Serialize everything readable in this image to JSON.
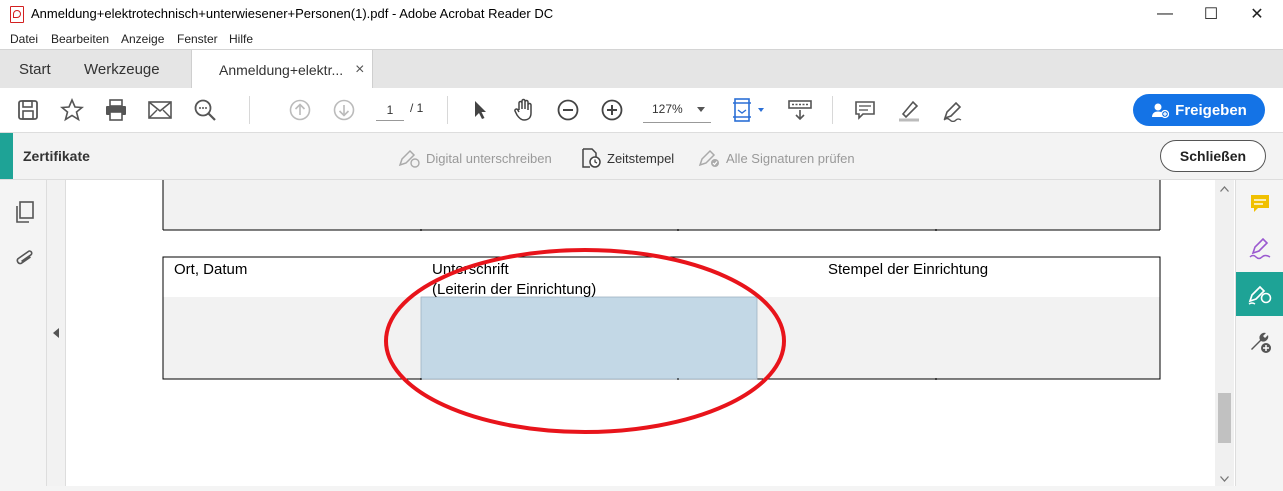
{
  "window": {
    "title": "Anmeldung+elektrotechnisch+unterwiesener+Personen(1).pdf - Adobe Acrobat Reader DC",
    "minimize": "—",
    "maximize": "☐",
    "close": "✕"
  },
  "menu": [
    "Datei",
    "Bearbeiten",
    "Anzeige",
    "Fenster",
    "Hilfe"
  ],
  "tabs": {
    "start": "Start",
    "tools": "Werkzeuge",
    "document": "Anmeldung+elektr...",
    "document_close": "×"
  },
  "toolbar": {
    "page_current": "1",
    "page_total": "/ 1",
    "zoom": "127%",
    "share_label": "Freigeben"
  },
  "certbar": {
    "title": "Zertifikate",
    "digital_sign": "Digital unterschreiben",
    "timestamp": "Zeitstempel",
    "verify_all": "Alle Signaturen prüfen",
    "close": "Schließen"
  },
  "document": {
    "col_place_date": "Ort, Datum",
    "col_signature_line1": "Unterschrift",
    "col_signature_line2": "(Leiterin der Einrichtung)",
    "col_stamp": "Stempel der Einrichtung"
  },
  "colors": {
    "accent_teal": "#1ea396",
    "share_blue": "#1473e6",
    "highlight_ellipse": "#e8141b",
    "signature_field": "#c3d8e6"
  },
  "icons": [
    "save-icon",
    "bookmark-star-icon",
    "print-icon",
    "mail-icon",
    "search-zoom-icon",
    "page-up-icon",
    "page-down-icon",
    "select-cursor-icon",
    "hand-icon",
    "zoom-out-icon",
    "zoom-in-icon",
    "fit-page-icon",
    "read-mode-icon",
    "comment-icon",
    "highlight-pen-icon",
    "sign-icon",
    "pages-icon",
    "attachment-icon"
  ]
}
